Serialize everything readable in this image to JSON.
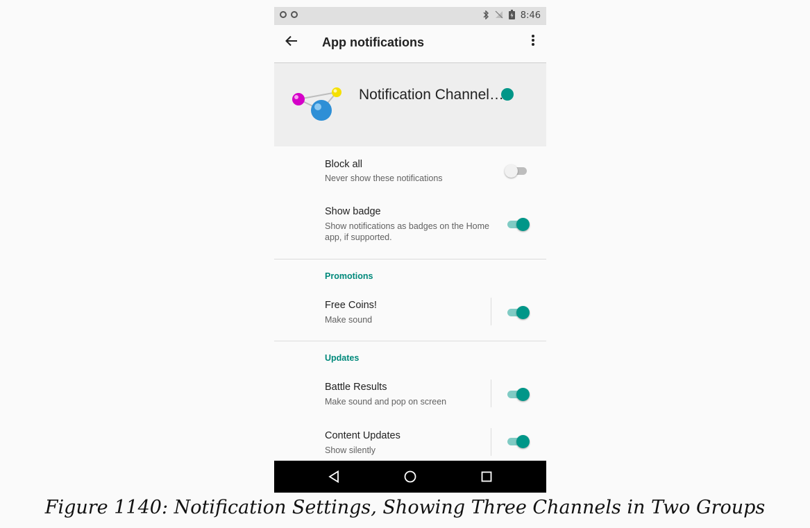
{
  "status_bar": {
    "time": "8:46",
    "bluetooth_icon": "bluetooth-icon",
    "signal_icon": "no-signal-icon",
    "battery_icon": "battery-icon"
  },
  "appbar": {
    "title": "App notifications",
    "back_icon": "arrow-back-icon",
    "overflow_icon": "more-vert-icon"
  },
  "app_header": {
    "name": "Notification Channel…"
  },
  "settings": {
    "block_all": {
      "title": "Block all",
      "summary": "Never show these notifications",
      "enabled": false
    },
    "show_badge": {
      "title": "Show badge",
      "summary": "Show notifications as badges on the Home app, if supported.",
      "enabled": true
    }
  },
  "groups": [
    {
      "header": "Promotions",
      "channels": [
        {
          "title": "Free Coins!",
          "summary": "Make sound",
          "enabled": true
        }
      ]
    },
    {
      "header": "Updates",
      "channels": [
        {
          "title": "Battle Results",
          "summary": "Make sound and pop on screen",
          "enabled": true
        },
        {
          "title": "Content Updates",
          "summary": "Show silently",
          "enabled": true
        }
      ]
    }
  ],
  "navbar": {
    "back_icon": "nav-back-icon",
    "home_icon": "nav-home-icon",
    "recents_icon": "nav-recents-icon"
  },
  "caption": "Figure 1140: Notification Settings, Showing Three Channels in Two Groups",
  "colors": {
    "accent": "#009688",
    "accent_light": "#80cbc4",
    "group_header": "#00897b"
  }
}
